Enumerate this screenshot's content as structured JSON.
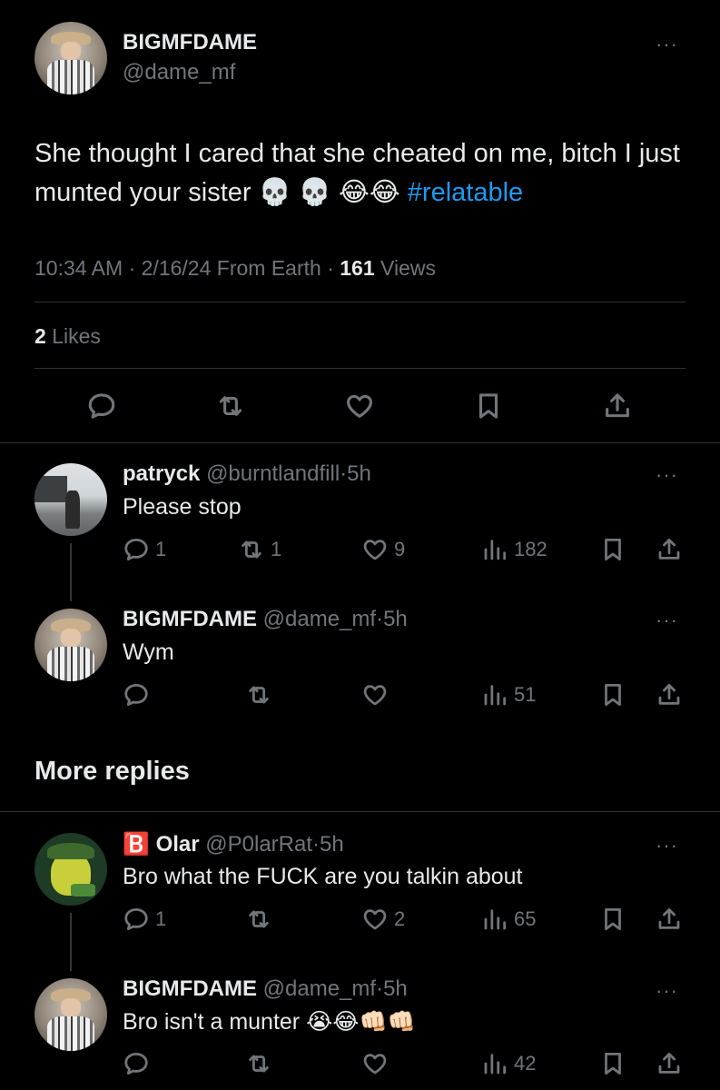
{
  "main_post": {
    "display_name": "BIGMFDAME",
    "handle": "@dame_mf",
    "text": "She thought I cared that she cheated on me, bitch I just munted your sister",
    "emojis": "💀 💀 😂😂",
    "hashtag": "#relatable",
    "time": "10:34 AM",
    "date": "2/16/24 From Earth",
    "views_count": "161",
    "views_label": "Views",
    "likes_count": "2",
    "likes_label": "Likes",
    "more_label": "···"
  },
  "separator": "·",
  "replies": [
    {
      "display_name": "patryck",
      "handle": "@burntlandfill",
      "time": "5h",
      "text": "Please stop",
      "reply_count": "1",
      "retweet_count": "1",
      "like_count": "9",
      "view_count": "182"
    },
    {
      "display_name": "BIGMFDAME",
      "handle": "@dame_mf",
      "time": "5h",
      "text": "Wym",
      "reply_count": "",
      "retweet_count": "",
      "like_count": "",
      "view_count": "51"
    }
  ],
  "more_replies_label": "More replies",
  "more_replies": [
    {
      "badge": "🅱️",
      "display_name": "Olar",
      "handle": "@P0larRat",
      "time": "5h",
      "text": "Bro what the FUCK are you talkin about",
      "reply_count": "1",
      "retweet_count": "",
      "like_count": "2",
      "view_count": "65"
    },
    {
      "display_name": "BIGMFDAME",
      "handle": "@dame_mf",
      "time": "5h",
      "text": "Bro isn't a munter",
      "emojis": "😭😂👊🏻👊🏻",
      "reply_count": "",
      "retweet_count": "",
      "like_count": "",
      "view_count": "42"
    }
  ],
  "icons": [
    "reply-icon",
    "retweet-icon",
    "like-icon",
    "bookmark-icon",
    "share-icon",
    "views-icon",
    "more-icon"
  ],
  "colors": {
    "background": "#000000",
    "text": "#e7e9ea",
    "muted": "#71767b",
    "link": "#1d9bf0",
    "divider": "#2f3336"
  }
}
